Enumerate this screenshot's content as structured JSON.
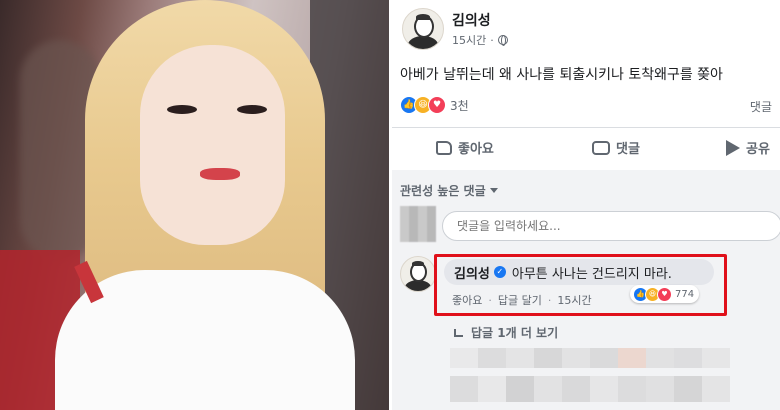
{
  "post": {
    "author": "김의성",
    "time": "15시간",
    "text": "아베가 날뛰는데 왜 사나를 퇴출시키나 토착왜구를 쫒아",
    "reaction_count": "3천",
    "comments_link": "댓글"
  },
  "actions": {
    "like": "좋아요",
    "comment": "댓글",
    "share": "공유"
  },
  "comments_section": {
    "sort_label": "관련성 높은 댓글",
    "input_placeholder": "댓글을 입력하세요...",
    "comment": {
      "author": "김의성",
      "text": "아무튼 사나는 건드리지 마라.",
      "like_action": "좋아요",
      "reply_action": "답글 달기",
      "time": "15시간",
      "reaction_count": "774"
    },
    "more_replies": "답글 1개 더 보기"
  },
  "colors": {
    "like": "#1877f2",
    "haha": "#f7b125",
    "love": "#f33e58",
    "highlight": "#e0101a"
  },
  "icons": [
    "globe-icon",
    "like-thumb-icon",
    "comment-bubble-icon",
    "share-arrow-icon",
    "verified-badge-icon",
    "caret-down-icon",
    "reply-arrow-icon"
  ]
}
